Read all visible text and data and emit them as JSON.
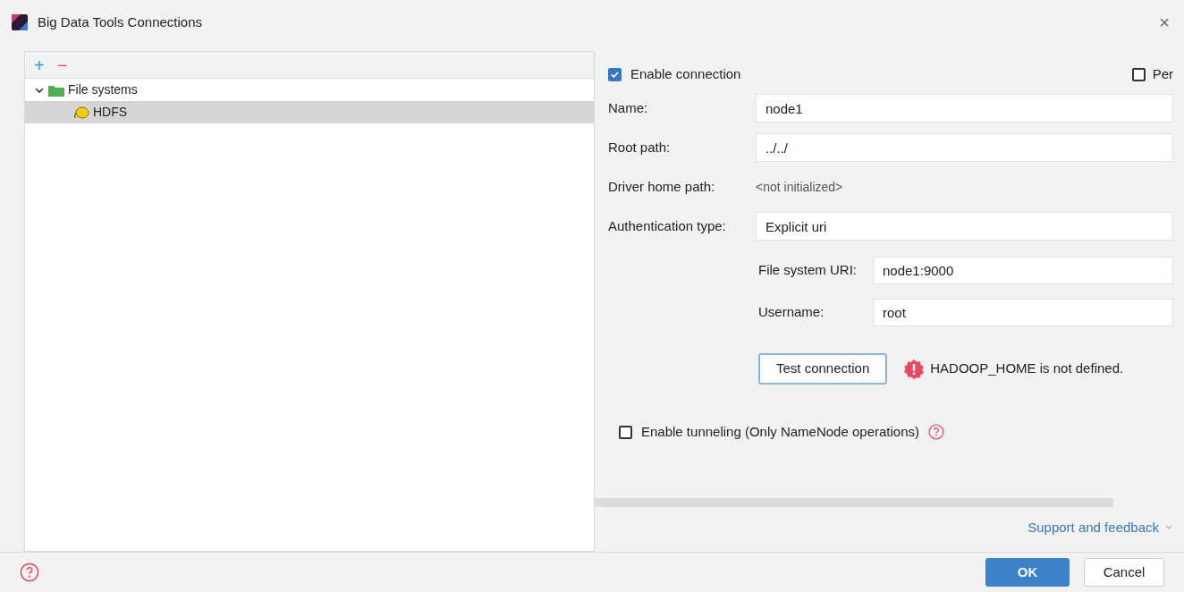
{
  "window": {
    "title": "Big Data Tools Connections",
    "close": "×"
  },
  "toolbar": {
    "add": "+",
    "remove": "−"
  },
  "tree": [
    {
      "label": "File systems",
      "expanded": true,
      "selected": false,
      "kind": "folder",
      "children": [
        {
          "label": "HDFS",
          "selected": true,
          "kind": "hdfs"
        }
      ]
    }
  ],
  "enable_connection": {
    "label": "Enable connection",
    "checked": true
  },
  "per_checkbox": {
    "label": "Per",
    "checked": false
  },
  "fields": [
    {
      "label": "Name:",
      "value": "node1",
      "kind": "input"
    },
    {
      "label": "Root path:",
      "value": "../../",
      "kind": "input"
    },
    {
      "label": "Driver home path:",
      "value": "<not initialized>",
      "kind": "text"
    },
    {
      "label": "Authentication type:",
      "value": "Explicit uri",
      "kind": "input"
    }
  ],
  "sub_fields": [
    {
      "label": "File system URI:",
      "value": "node1:9000"
    },
    {
      "label": "Username:",
      "value": "root"
    }
  ],
  "test_button": "Test connection",
  "error_message": "HADOOP_HOME is not defined.",
  "tunneling": {
    "label": "Enable tunneling (Only NameNode operations)",
    "checked": false
  },
  "support_link": "Support and feedback",
  "buttons": [
    {
      "label": "OK",
      "kind": "primary"
    },
    {
      "label": "Cancel",
      "kind": "secondary"
    }
  ]
}
